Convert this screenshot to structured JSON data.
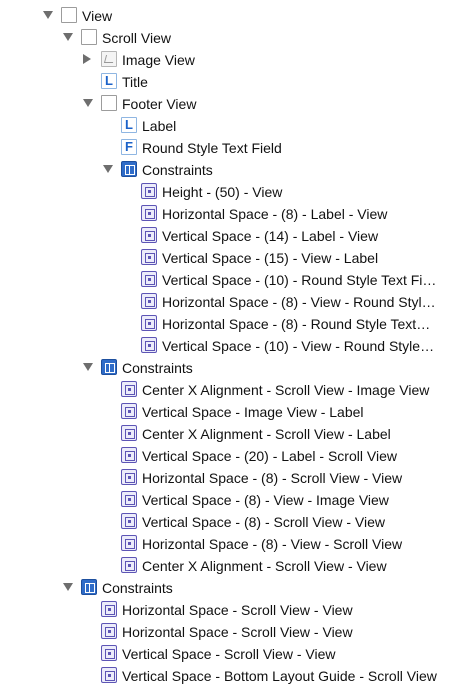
{
  "rows": [
    {
      "depth": 0,
      "disclosure": "down",
      "icon": "view-icon",
      "label": "View"
    },
    {
      "depth": 1,
      "disclosure": "down",
      "icon": "view-icon",
      "label": "Scroll View"
    },
    {
      "depth": 2,
      "disclosure": "right",
      "icon": "image-view-icon",
      "label": "Image View"
    },
    {
      "depth": 2,
      "disclosure": "",
      "icon": "label-icon",
      "label": "Title"
    },
    {
      "depth": 2,
      "disclosure": "down",
      "icon": "view-icon",
      "label": "Footer View"
    },
    {
      "depth": 3,
      "disclosure": "",
      "icon": "label-icon",
      "label": "Label"
    },
    {
      "depth": 3,
      "disclosure": "",
      "icon": "text-field-icon",
      "label": "Round Style Text Field"
    },
    {
      "depth": 3,
      "disclosure": "down",
      "icon": "constraints-group-icon",
      "label": "Constraints"
    },
    {
      "depth": 4,
      "disclosure": "",
      "icon": "constraint-icon",
      "label": "Height - (50) - View"
    },
    {
      "depth": 4,
      "disclosure": "",
      "icon": "constraint-icon",
      "label": "Horizontal Space - (8) - Label - View"
    },
    {
      "depth": 4,
      "disclosure": "",
      "icon": "constraint-icon",
      "label": "Vertical Space - (14) - Label - View"
    },
    {
      "depth": 4,
      "disclosure": "",
      "icon": "constraint-icon",
      "label": "Vertical Space - (15) - View - Label"
    },
    {
      "depth": 4,
      "disclosure": "",
      "icon": "constraint-icon",
      "label": "Vertical Space - (10) - Round Style Text Fi…"
    },
    {
      "depth": 4,
      "disclosure": "",
      "icon": "constraint-icon",
      "label": "Horizontal Space - (8) - View - Round Styl…"
    },
    {
      "depth": 4,
      "disclosure": "",
      "icon": "constraint-icon",
      "label": "Horizontal Space - (8) - Round Style Text…"
    },
    {
      "depth": 4,
      "disclosure": "",
      "icon": "constraint-icon",
      "label": "Vertical Space - (10) - View - Round Style…"
    },
    {
      "depth": 2,
      "disclosure": "down",
      "icon": "constraints-group-icon",
      "label": "Constraints"
    },
    {
      "depth": 3,
      "disclosure": "",
      "icon": "constraint-icon",
      "label": "Center X Alignment - Scroll View - Image View"
    },
    {
      "depth": 3,
      "disclosure": "",
      "icon": "constraint-icon",
      "label": "Vertical Space - Image View - Label"
    },
    {
      "depth": 3,
      "disclosure": "",
      "icon": "constraint-icon",
      "label": "Center X Alignment - Scroll View - Label"
    },
    {
      "depth": 3,
      "disclosure": "",
      "icon": "constraint-icon",
      "label": "Vertical Space - (20) - Label - Scroll View"
    },
    {
      "depth": 3,
      "disclosure": "",
      "icon": "constraint-icon",
      "label": "Horizontal Space - (8) - Scroll View - View"
    },
    {
      "depth": 3,
      "disclosure": "",
      "icon": "constraint-icon",
      "label": "Vertical Space - (8) - View - Image View"
    },
    {
      "depth": 3,
      "disclosure": "",
      "icon": "constraint-icon",
      "label": "Vertical Space - (8) - Scroll View - View"
    },
    {
      "depth": 3,
      "disclosure": "",
      "icon": "constraint-icon",
      "label": "Horizontal Space - (8) - View - Scroll View"
    },
    {
      "depth": 3,
      "disclosure": "",
      "icon": "constraint-icon",
      "label": "Center X Alignment - Scroll View - View"
    },
    {
      "depth": 1,
      "disclosure": "down",
      "icon": "constraints-group-icon",
      "label": "Constraints"
    },
    {
      "depth": 2,
      "disclosure": "",
      "icon": "constraint-icon",
      "label": "Horizontal Space - Scroll View - View"
    },
    {
      "depth": 2,
      "disclosure": "",
      "icon": "constraint-icon",
      "label": "Horizontal Space - Scroll View - View"
    },
    {
      "depth": 2,
      "disclosure": "",
      "icon": "constraint-icon",
      "label": "Vertical Space - Scroll View - View"
    },
    {
      "depth": 2,
      "disclosure": "",
      "icon": "constraint-icon",
      "label": "Vertical Space - Bottom Layout Guide - Scroll View"
    }
  ]
}
